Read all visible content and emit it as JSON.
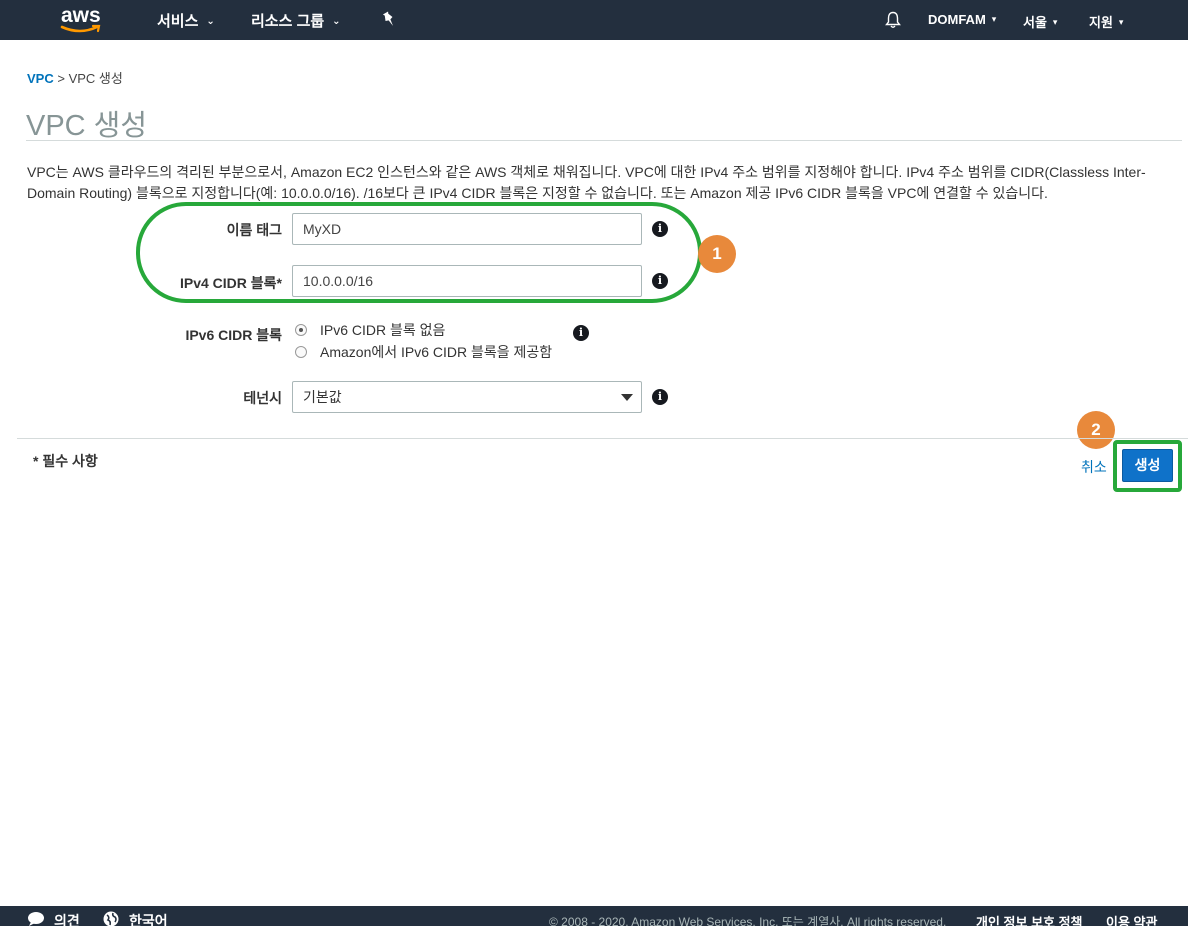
{
  "nav": {
    "logo": "aws",
    "services": "서비스",
    "resource_groups": "리소스 그룹",
    "account": "DOMFAM",
    "region": "서울",
    "support": "지원"
  },
  "breadcrumb": {
    "root": "VPC",
    "separator": " > ",
    "current": "VPC 생성"
  },
  "page": {
    "title": "VPC 생성",
    "description": "VPC는 AWS 클라우드의 격리된 부분으로서, Amazon EC2 인스턴스와 같은 AWS 객체로 채워집니다. VPC에 대한 IPv4 주소 범위를 지정해야 합니다. IPv4 주소 범위를 CIDR(Classless Inter-Domain Routing) 블록으로 지정합니다(예: 10.0.0.0/16). /16보다 큰 IPv4 CIDR 블록은 지정할 수 없습니다. 또는 Amazon 제공 IPv6 CIDR 블록을 VPC에 연결할 수 있습니다."
  },
  "form": {
    "name_tag_label": "이름 태그",
    "name_tag_value": "MyXD",
    "ipv4_label": "IPv4 CIDR 블록*",
    "ipv4_value": "10.0.0.0/16",
    "ipv6_label": "IPv6 CIDR 블록",
    "ipv6_options": [
      "IPv6 CIDR 블록 없음",
      "Amazon에서 IPv6 CIDR 블록을 제공함"
    ],
    "ipv6_selected": "IPv6 CIDR 블록 없음",
    "tenancy_label": "테넌시",
    "tenancy_value": "기본값",
    "required_note": "* 필수 사항",
    "cancel": "취소",
    "create": "생성"
  },
  "annotations": {
    "badge1": "1",
    "badge2": "2",
    "highlight_color": "#27a83a",
    "badge_color": "#e8893b"
  },
  "footer": {
    "feedback": "의견",
    "language": "한국어",
    "copyright": "© 2008 - 2020, Amazon Web Services, Inc. 또는 계열사. All rights reserved.",
    "privacy": "개인 정보 보호 정책",
    "terms": "이용 약관"
  }
}
